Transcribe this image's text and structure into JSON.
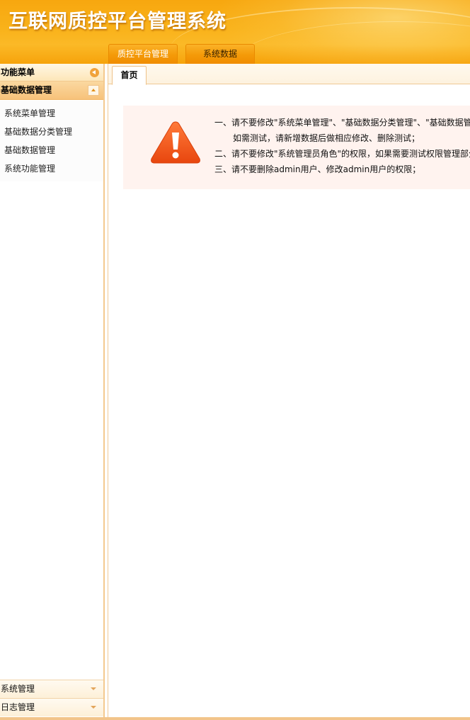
{
  "app": {
    "title": "互联网质控平台管理系统"
  },
  "nav_tabs": [
    {
      "label": "质控平台管理"
    },
    {
      "label": "系统数据"
    }
  ],
  "sidebar": {
    "header": "功能菜单",
    "group": {
      "label": "基础数据管理",
      "items": [
        {
          "label": "系统菜单管理"
        },
        {
          "label": "基础数据分类管理"
        },
        {
          "label": "基础数据管理"
        },
        {
          "label": "系统功能管理"
        }
      ]
    },
    "collapsed_groups": [
      {
        "label": "系统管理"
      },
      {
        "label": "日志管理"
      }
    ]
  },
  "main": {
    "tabs": [
      {
        "label": "首页"
      }
    ],
    "notice": {
      "lines": [
        "一、请不要修改\"系统菜单管理\"、\"基础数据分类管理\"、\"基础数据管理\"",
        "如需测试，请新增数据后做相应修改、删除测试；",
        "二、请不要修改\"系统管理员角色\"的权限，如果需要测试权限管理部分",
        "三、请不要删除admin用户、修改admin用户的权限；"
      ]
    }
  },
  "colors": {
    "header_orange": "#f7a70f",
    "accent": "#f0a23a",
    "warning_icon": "#f25a1e",
    "notice_background": "#fff3ef"
  }
}
